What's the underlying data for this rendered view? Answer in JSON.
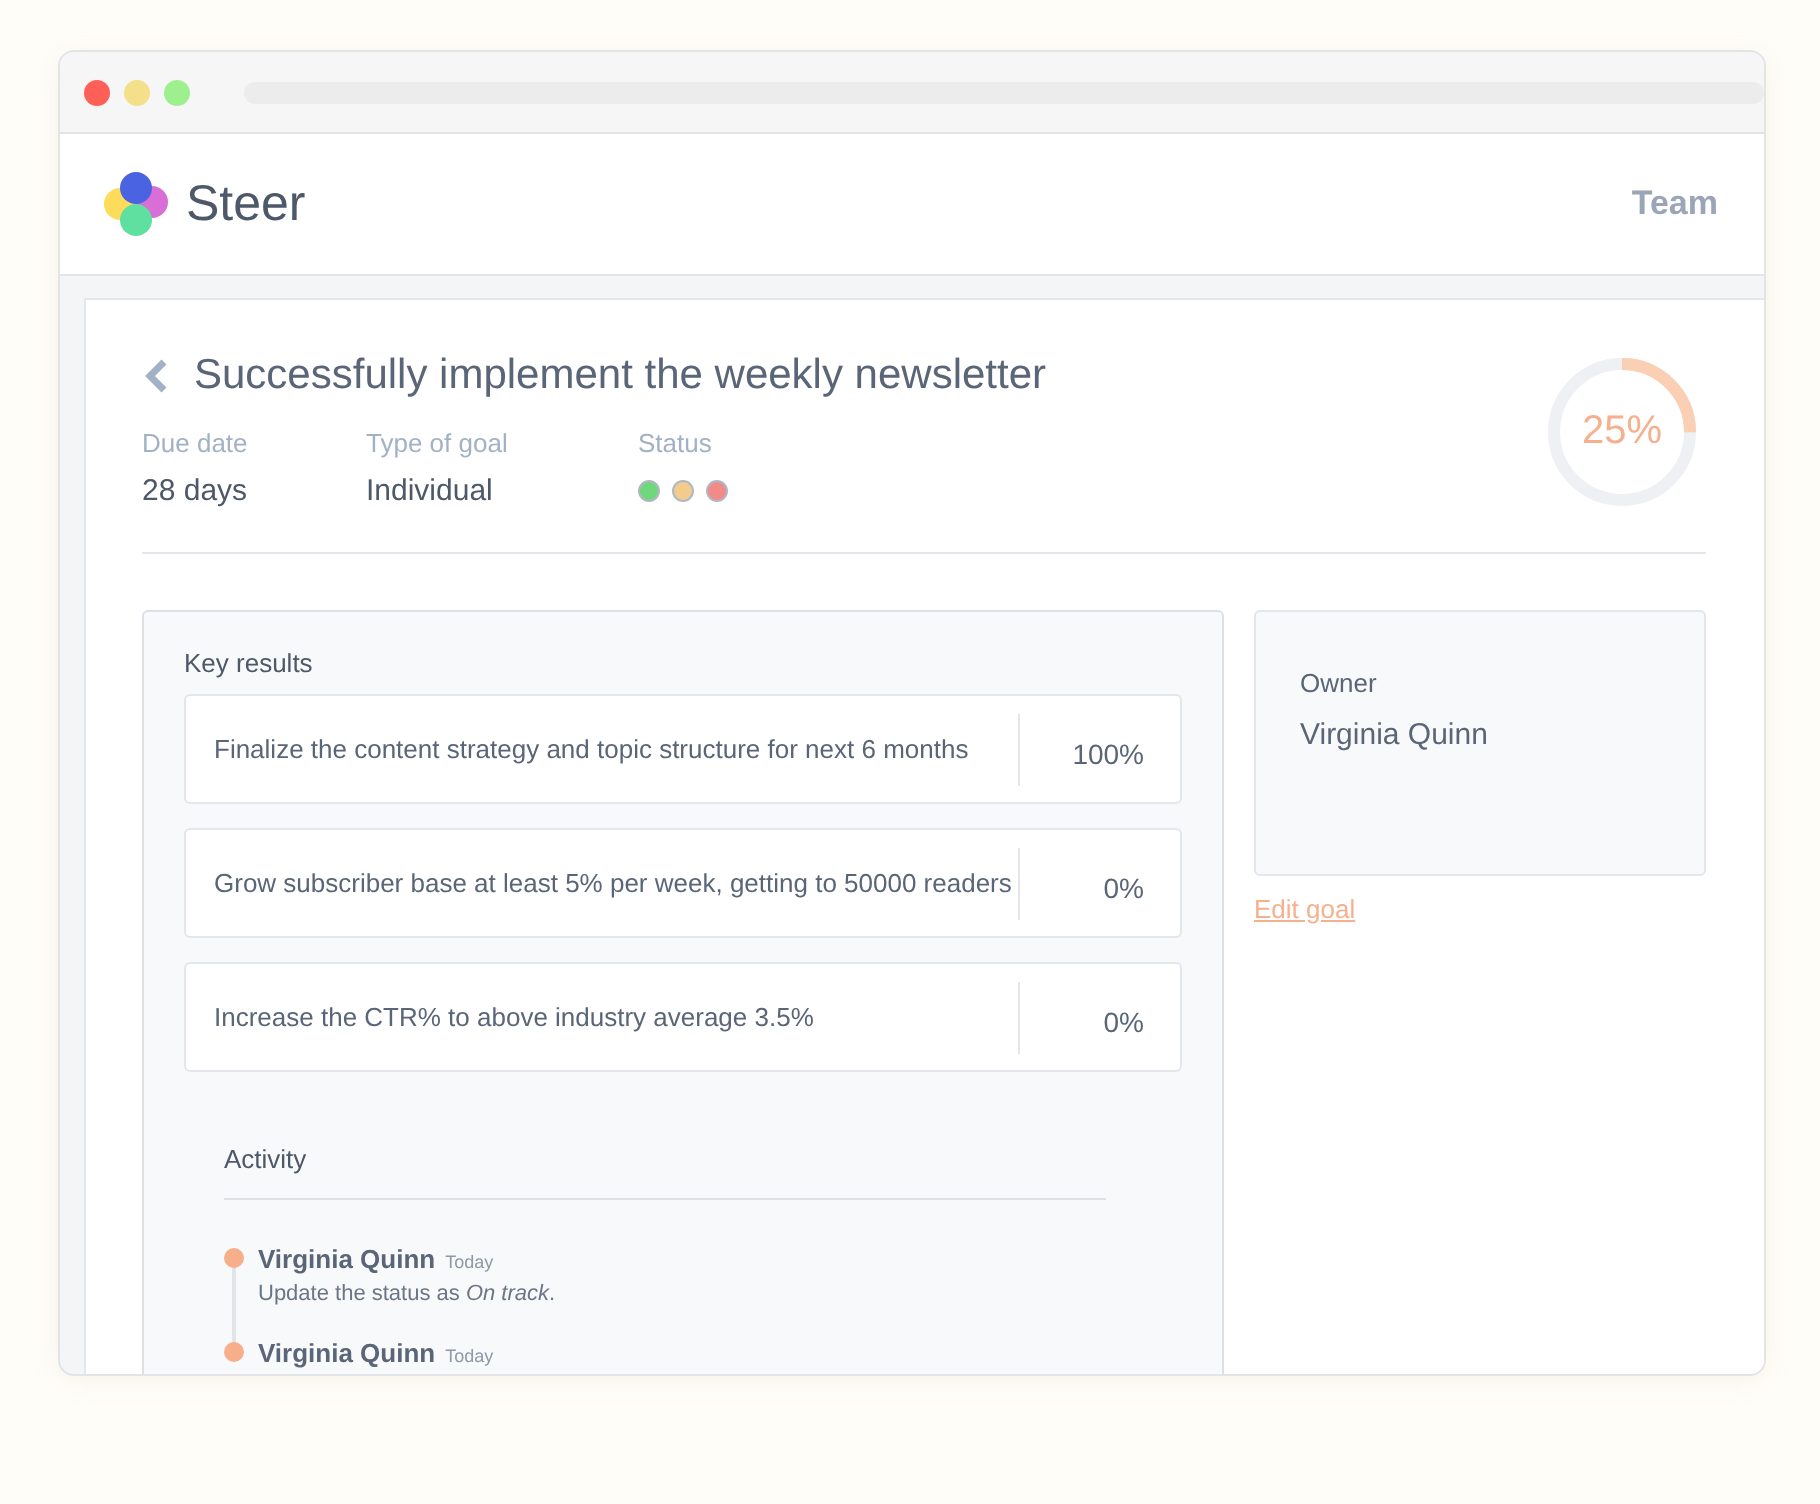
{
  "brand": {
    "name": "Steer"
  },
  "nav": {
    "label": "Team"
  },
  "goal": {
    "title": "Successfully implement the weekly newsletter",
    "meta": [
      {
        "label": "Due date",
        "value": "28 days"
      },
      {
        "label": "Type of goal",
        "value": "Individual"
      }
    ],
    "status": {
      "label": "Status",
      "dots": [
        {
          "color": "#6fd87c"
        },
        {
          "color": "#f3cb8b"
        },
        {
          "color": "#f28a8a"
        }
      ]
    },
    "progress": {
      "level": 0.25,
      "reading": "25%"
    }
  },
  "key_results": {
    "title": "Key results",
    "items": [
      {
        "text": "Finalize the content strategy and topic structure for next 6 months",
        "value": "100%"
      },
      {
        "text": "Grow subscriber base at least 5% per week, getting to 50000 readers",
        "value": "0%"
      },
      {
        "text": "Increase the CTR% to above industry average 3.5%",
        "value": "0%"
      }
    ]
  },
  "activity": {
    "title": "Activity",
    "entries": [
      {
        "name": "Virginia Quinn",
        "time": "Today",
        "text": "Update the status as *On track*."
      },
      {
        "name": "Virginia Quinn",
        "time": "Today"
      }
    ]
  },
  "owner": {
    "label": "Owner",
    "name": "Virginia Quinn"
  },
  "edit_link": "Edit goal"
}
